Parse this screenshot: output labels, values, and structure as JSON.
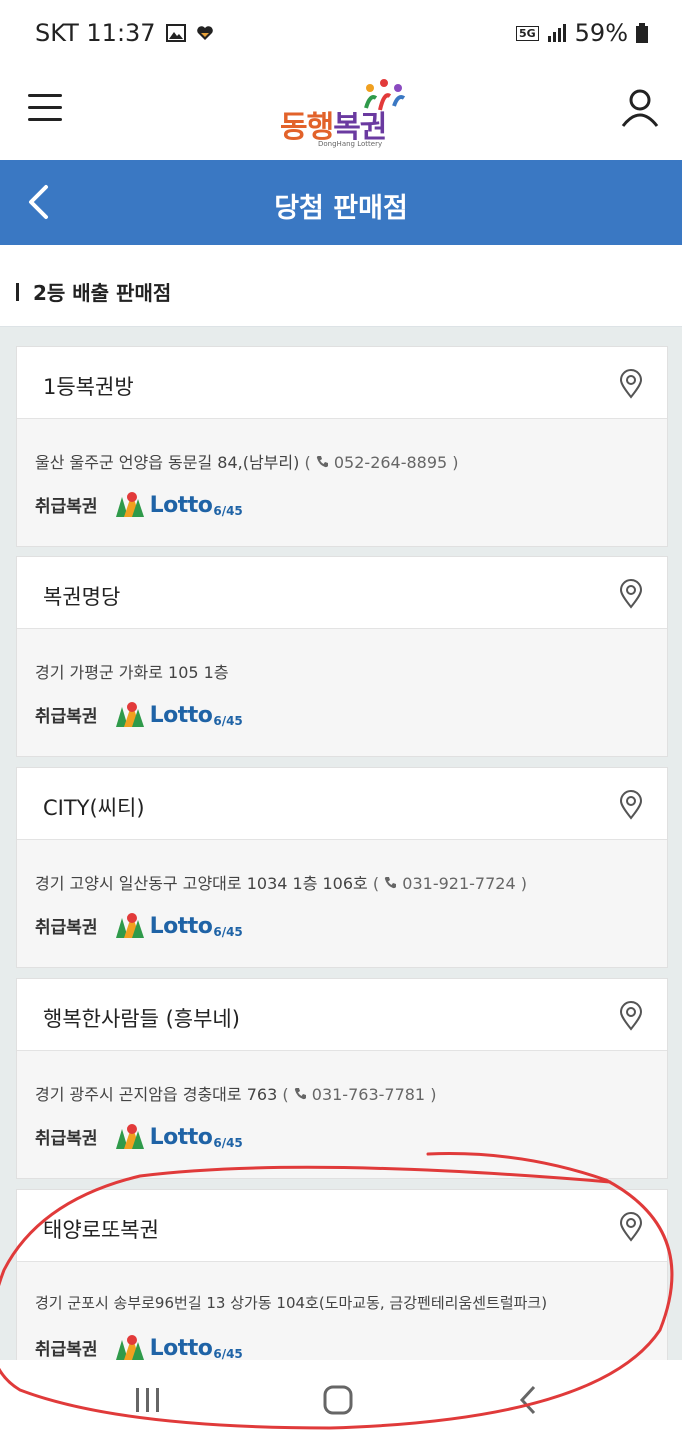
{
  "status_bar": {
    "carrier_time": "SKT 11:37",
    "network": "5G",
    "battery": "59%"
  },
  "header": {
    "logo_main_1": "동행",
    "logo_main_2": "복권",
    "logo_sub": "DongHang Lottery"
  },
  "title_bar": {
    "title": "당첨 판매점"
  },
  "section": {
    "title": "2등 배출 판매점"
  },
  "lotto_logo": {
    "word": "Lotto",
    "sub": "6/45"
  },
  "handle_label": "취급복권",
  "stores": [
    {
      "name": "1등복권방",
      "address": "울산 울주군 언양읍 동문길 84,(남부리)",
      "phone": "052-264-8895"
    },
    {
      "name": "복권명당",
      "address": "경기 가평군 가화로 105 1층",
      "phone": ""
    },
    {
      "name": "CITY(씨티)",
      "address": "경기 고양시 일산동구 고양대로 1034 1층 106호",
      "phone": "031-921-7724"
    },
    {
      "name": "행복한사람들 (흥부네)",
      "address": "경기 광주시 곤지암읍 경충대로 763",
      "phone": "031-763-7781"
    },
    {
      "name": "태양로또복권",
      "address": "경기 군포시 송부로96번길 13 상가동 104호(도마교동, 금강펜테리움센트럴파크)",
      "phone": ""
    }
  ],
  "colors": {
    "header_blue": "#3a78c3",
    "annotation_red": "#e03a3a",
    "lotto_blue": "#1f63a6"
  }
}
